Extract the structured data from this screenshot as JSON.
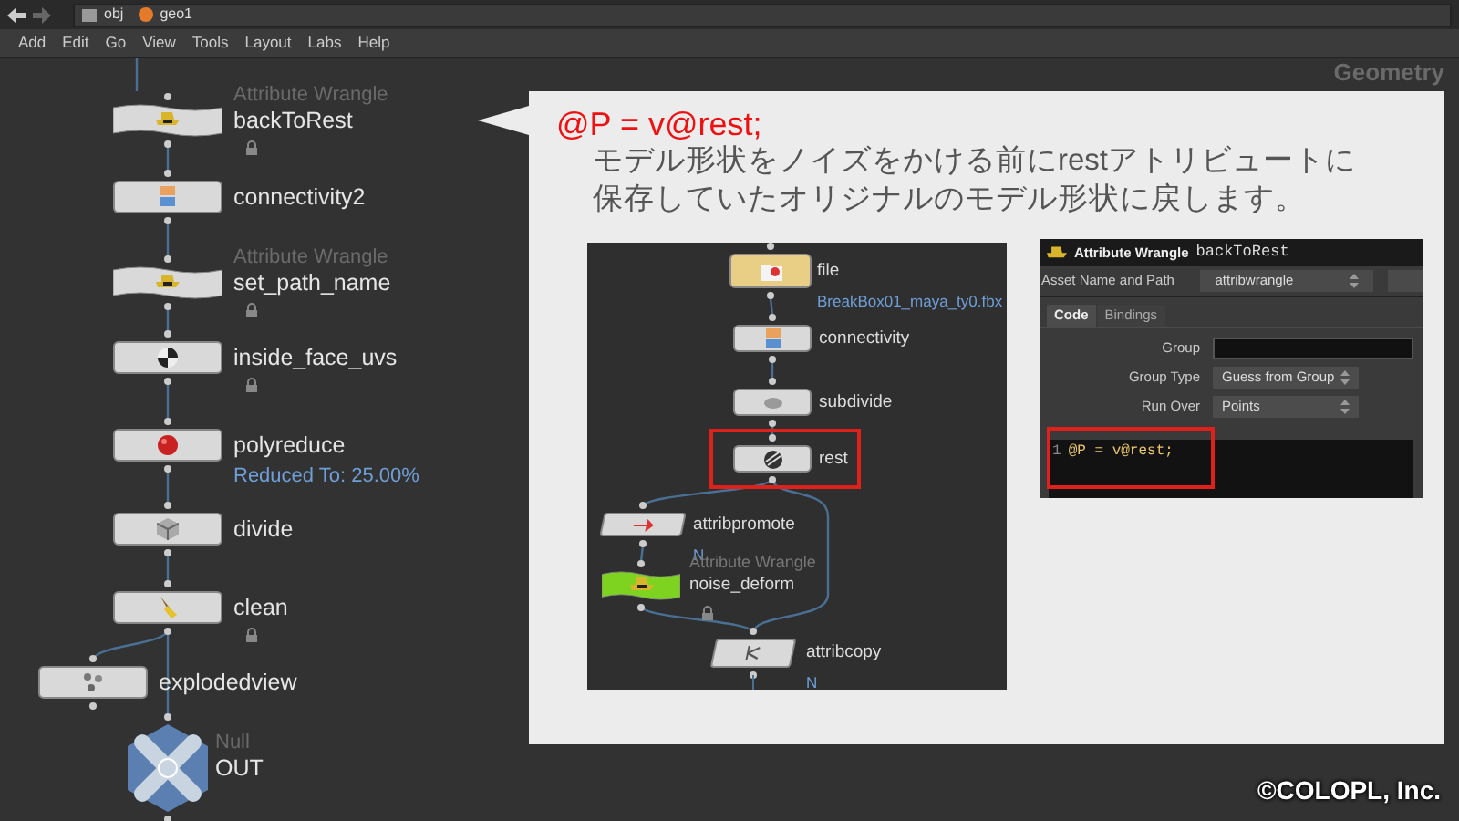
{
  "path_bar": {
    "items": [
      "obj",
      "geo1"
    ]
  },
  "menu": [
    "Add",
    "Edit",
    "Go",
    "View",
    "Tools",
    "Layout",
    "Labs",
    "Help"
  ],
  "network": {
    "watermark": "Geometry",
    "nodes": [
      {
        "type_label": "Attribute Wrangle",
        "name": "backToRest",
        "kind": "wrangle",
        "color": "#d9d9d9",
        "locked": true
      },
      {
        "name": "connectivity2",
        "kind": "box",
        "color": "#d9d9d9",
        "locked": false
      },
      {
        "type_label": "Attribute Wrangle",
        "name": "set_path_name",
        "kind": "wrangle",
        "color": "#d9d9d9",
        "locked": true
      },
      {
        "name": "inside_face_uvs",
        "kind": "box",
        "color": "#d9d9d9",
        "locked": true
      },
      {
        "name": "polyreduce",
        "kind": "box",
        "color": "#d9d9d9",
        "locked": false,
        "info": "Reduced To: 25.00%"
      },
      {
        "name": "divide",
        "kind": "box",
        "color": "#d9d9d9",
        "locked": false
      },
      {
        "name": "clean",
        "kind": "box",
        "color": "#d9d9d9",
        "locked": true
      },
      {
        "name": "explodedview",
        "kind": "box",
        "color": "#d9d9d9",
        "locked": false
      },
      {
        "type_label": "Null",
        "name": "OUT",
        "kind": "null",
        "color": "#5a7fb0",
        "locked": false
      }
    ]
  },
  "callout": {
    "code": "@P = v@rest;",
    "lines": [
      "モデル形状をノイズをかける前にrestアトリビュートに",
      "保存していたオリジナルのモデル形状に戻します。"
    ]
  },
  "inset_network": {
    "nodes": [
      {
        "name": "file",
        "kind": "box",
        "color": "#e8cf85",
        "info": "BreakBox01_maya_ty0.fbx",
        "locked": false,
        "highlighted": false
      },
      {
        "name": "connectivity",
        "kind": "box",
        "color": "#d9d9d9",
        "locked": false,
        "highlighted": false
      },
      {
        "name": "subdivide",
        "kind": "box",
        "color": "#d9d9d9",
        "locked": false,
        "highlighted": false
      },
      {
        "name": "rest",
        "kind": "box",
        "color": "#d9d9d9",
        "locked": false,
        "highlighted": true
      },
      {
        "name": "attribpromote",
        "kind": "skew",
        "color": "#d9d9d9",
        "info": "N",
        "locked": false,
        "highlighted": false
      },
      {
        "type_label": "Attribute Wrangle",
        "name": "noise_deform",
        "kind": "wrangle",
        "color": "#7ed321",
        "locked": true,
        "highlighted": false
      },
      {
        "name": "attribcopy",
        "kind": "skew",
        "color": "#d9d9d9",
        "info": "N",
        "locked": false,
        "highlighted": false
      }
    ]
  },
  "parameters": {
    "header": {
      "type": "Attribute Wrangle",
      "name": "backToRest"
    },
    "asset_row": {
      "label": "Asset Name and Path",
      "value": "attribwrangle"
    },
    "tabs": [
      {
        "label": "Code",
        "selected": true
      },
      {
        "label": "Bindings",
        "selected": false
      }
    ],
    "fields": [
      {
        "label": "Group",
        "kind": "input"
      },
      {
        "label": "Group Type",
        "kind": "menu",
        "value": "Guess from Group"
      },
      {
        "label": "Run Over",
        "kind": "menu",
        "value": "Points"
      }
    ],
    "code": {
      "line_number": "1",
      "text": "@P = v@rest;",
      "highlighted": true
    }
  },
  "copyright": "©COLOPL, Inc."
}
